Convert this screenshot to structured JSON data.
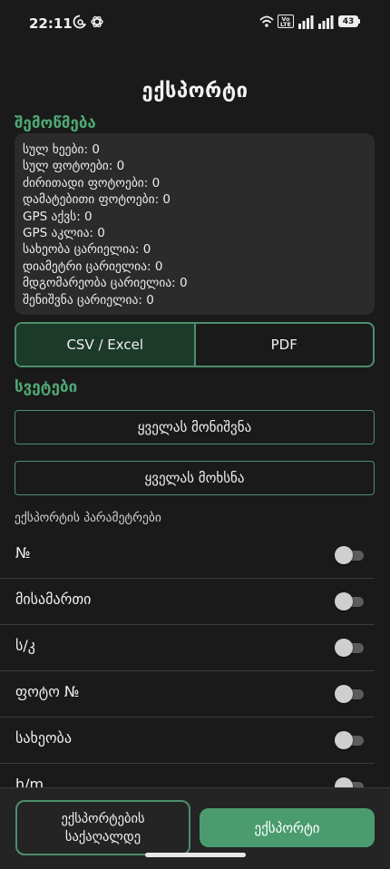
{
  "status": {
    "time": "22:11",
    "volte_badge": "Vo LTE",
    "battery": "43"
  },
  "screen_title": "ექსპორტი",
  "check": {
    "title": "შემოწმება",
    "lines": [
      "სულ ხეები: 0",
      "სულ ფოტოები: 0",
      "ძირითადი ფოტოები: 0",
      "დამატებითი ფოტოები: 0",
      "GPS აქვს: 0",
      "GPS აკლია: 0",
      "სახეობა ცარიელია: 0",
      "დიამეტრი ცარიელია: 0",
      "მდგომარეობა ცარიელია: 0",
      "შენიშვნა ცარიელია: 0"
    ]
  },
  "format": {
    "options": [
      "CSV / Excel",
      "PDF"
    ],
    "selected": "CSV / Excel"
  },
  "columns": {
    "title": "სვეტები",
    "select_all": "ყველას მონიშვნა",
    "deselect_all": "ყველას მოხსნა",
    "params_label": "ექსპორტის პარამეტრები",
    "items": [
      {
        "label": "№",
        "enabled": false
      },
      {
        "label": "მისამართი",
        "enabled": false
      },
      {
        "label": "ს/კ",
        "enabled": false
      },
      {
        "label": "ფოტო №",
        "enabled": false
      },
      {
        "label": "სახეობა",
        "enabled": false
      },
      {
        "label": "h/m",
        "enabled": false
      }
    ]
  },
  "bottom": {
    "folder_line1": "ექსპორტების",
    "folder_line2": "საქაღალდე",
    "export_button": "ექსპორტი"
  }
}
